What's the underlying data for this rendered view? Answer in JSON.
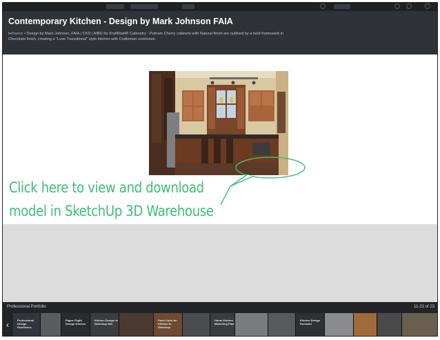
{
  "header": {
    "title": "Contemporary Kitchen - Design by Mark Johnson FAIA",
    "source": "behance",
    "description": " • Design by Mark Johnson, FAIA | CKD | AIBD for KraftMaid® Cabinetry - Putnam Cherry cabinets with Natural finish are outlined by a bold framework in Chocolate finish, creating a \"Luxe Transitional\" style kitchen with Craftsman overtones."
  },
  "callout": {
    "line1": "Click here to view and download",
    "line2": "model in SketchUp 3D Warehouse"
  },
  "portfolio": {
    "label": "Professional Portfolio",
    "count": "11-23 of 23",
    "prev_glyph": "‹",
    "thumbnails": [
      {
        "title": "Professional Design Excellence"
      },
      {
        "title": ""
      },
      {
        "title": "Pages Flight Design Kitchen"
      },
      {
        "title": "Kitchen Design to Sketchup Win"
      },
      {
        "title": ""
      },
      {
        "title": "Paint Color for Kitchen to Sketchup"
      },
      {
        "title": ""
      },
      {
        "title": "Home Kitchen Marketing Plans"
      },
      {
        "title": ""
      },
      {
        "title": ""
      },
      {
        "title": "Kitchen Design Remodel"
      },
      {
        "title": ""
      },
      {
        "title": ""
      },
      {
        "title": ""
      },
      {
        "title": ""
      }
    ]
  },
  "colors": {
    "header_bg": "#2f3237",
    "callout_green": "#3bbf78",
    "gray_area": "#dcdcdc",
    "strip_bg": "#222428"
  }
}
